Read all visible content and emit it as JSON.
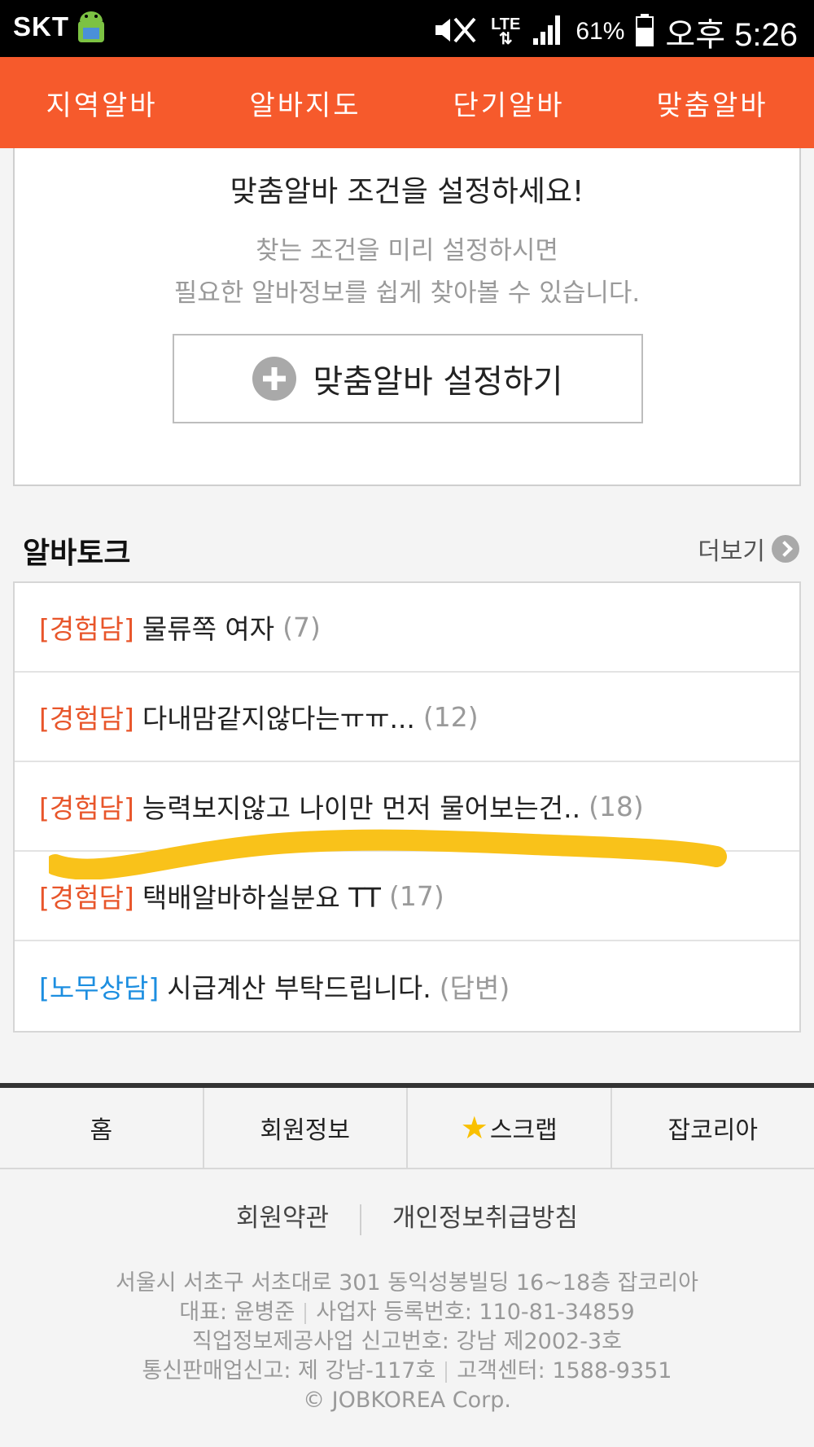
{
  "status_bar": {
    "carrier": "SKT",
    "network": "LTE",
    "battery": "61%",
    "time": "오후 5:26"
  },
  "top_nav": {
    "tabs": [
      {
        "label": "지역알바"
      },
      {
        "label": "알바지도"
      },
      {
        "label": "단기알바"
      },
      {
        "label": "맞춤알바"
      }
    ]
  },
  "custom_setup": {
    "title": "맞춤알바 조건을 설정하세요!",
    "desc_line1": "찾는 조건을 미리 설정하시면",
    "desc_line2": "필요한 알바정보를 쉽게 찾아볼 수 있습니다.",
    "button_label": "맞춤알바 설정하기"
  },
  "alba_talk": {
    "heading": "알바토크",
    "more_label": "더보기",
    "items": [
      {
        "tag": "[경험담]",
        "title": "물류쪽 여자",
        "count": "(7)"
      },
      {
        "tag": "[경험담]",
        "title": "다내맘같지않다는ㅠㅠ...",
        "count": "(12)"
      },
      {
        "tag": "[경험담]",
        "title": "능력보지않고 나이만 먼저 물어보는건..",
        "count": "(18)"
      },
      {
        "tag": "[경험담]",
        "title": "택배알바하실분요 TT",
        "count": "(17)"
      },
      {
        "tag": "[노무상담]",
        "title": "시급계산 부탁드립니다.",
        "count": "(답변)"
      }
    ],
    "highlight_color": "#f9c21a"
  },
  "footer": {
    "nav": [
      {
        "label": "홈"
      },
      {
        "label": "회원정보"
      },
      {
        "label": "스크랩"
      },
      {
        "label": "잡코리아"
      }
    ],
    "terms_label": "회원약관",
    "privacy_label": "개인정보취급방침",
    "address": "서울시 서초구 서초대로 301 동익성봉빌딩 16~18층 잡코리아",
    "ceo": "대표: 윤병준",
    "business_no": "사업자 등록번호: 110-81-34859",
    "job_info_no": "직업정보제공사업 신고번호: 강남 제2002-3호",
    "mail_order": "통신판매업신고: 제 강남-117호",
    "cs_center": "고객센터: 1588-9351",
    "copyright": "© JOBKOREA Corp."
  },
  "colors": {
    "accent": "#f65a2c",
    "tag_experience": "#e8552a",
    "tag_labor": "#1c8ee0"
  }
}
